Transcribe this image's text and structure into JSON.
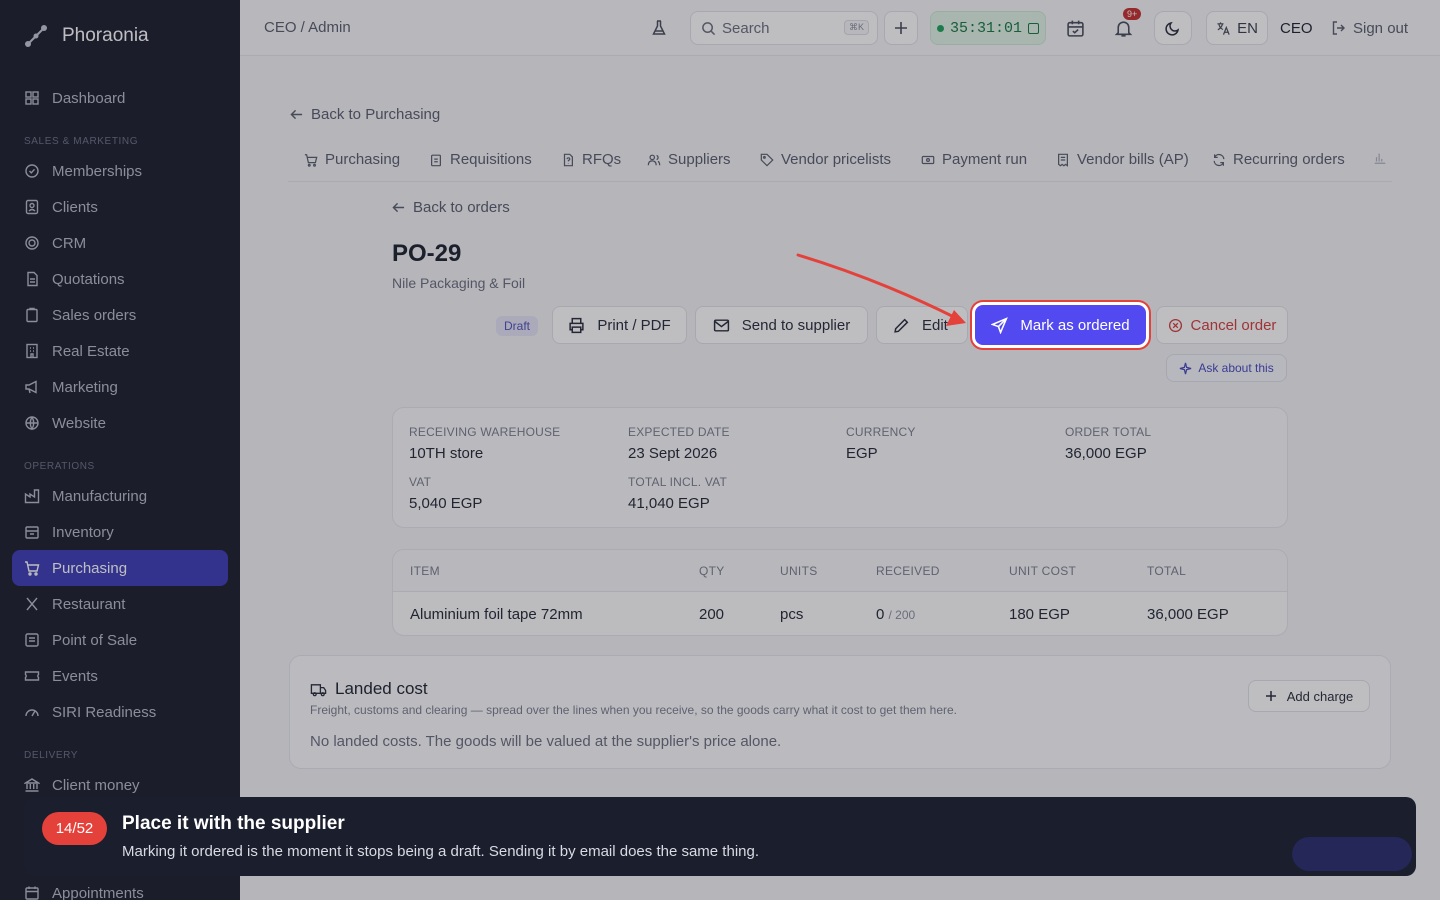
{
  "brand": {
    "name": "Phoraonia"
  },
  "sidebar": {
    "sections": {
      "sales": "SALES & MARKETING",
      "operations": "OPERATIONS",
      "delivery": "DELIVERY"
    },
    "items": [
      {
        "label": "Dashboard",
        "icon": "grid-icon"
      },
      {
        "label": "Memberships",
        "icon": "check-circle-icon"
      },
      {
        "label": "Clients",
        "icon": "contact-icon"
      },
      {
        "label": "CRM",
        "icon": "target-icon"
      },
      {
        "label": "Quotations",
        "icon": "file-icon"
      },
      {
        "label": "Sales orders",
        "icon": "clipboard-icon"
      },
      {
        "label": "Real Estate",
        "icon": "building-icon"
      },
      {
        "label": "Marketing",
        "icon": "megaphone-icon"
      },
      {
        "label": "Website",
        "icon": "globe-icon"
      },
      {
        "label": "Manufacturing",
        "icon": "factory-icon"
      },
      {
        "label": "Inventory",
        "icon": "box-icon"
      },
      {
        "label": "Purchasing",
        "icon": "cart-icon"
      },
      {
        "label": "Restaurant",
        "icon": "utensils-icon"
      },
      {
        "label": "Point of Sale",
        "icon": "terminal-icon"
      },
      {
        "label": "Events",
        "icon": "ticket-icon"
      },
      {
        "label": "SIRI Readiness",
        "icon": "gauge-icon"
      },
      {
        "label": "Client money",
        "icon": "bank-icon"
      },
      {
        "label": "Appointments",
        "icon": "calendar-icon"
      }
    ]
  },
  "topbar": {
    "breadcrumb": "CEO / Admin",
    "search_placeholder": "Search",
    "search_shortcut": "⌘K",
    "timer": "35:31:01",
    "notifications_badge": "9+",
    "language": "EN",
    "role": "CEO",
    "signout": "Sign out"
  },
  "page": {
    "back_purchasing": "Back to Purchasing",
    "tabs": [
      "Purchasing",
      "Requisitions",
      "RFQs",
      "Suppliers",
      "Vendor pricelists",
      "Payment run",
      "Vendor bills (AP)",
      "Recurring orders"
    ],
    "back_orders": "Back to orders",
    "title": "PO-29",
    "supplier": "Nile Packaging & Foil",
    "status": "Draft",
    "actions": {
      "print": "Print / PDF",
      "send": "Send to supplier",
      "edit": "Edit",
      "mark_ordered": "Mark as ordered",
      "cancel": "Cancel order",
      "ask": "Ask about this"
    },
    "summary": {
      "warehouse_label": "RECEIVING WAREHOUSE",
      "warehouse": "10TH store",
      "expected_label": "EXPECTED DATE",
      "expected": "23 Sept 2026",
      "currency_label": "CURRENCY",
      "currency": "EGP",
      "total_label": "ORDER TOTAL",
      "total": "36,000 EGP",
      "vat_label": "VAT",
      "vat": "5,040 EGP",
      "total_vat_label": "TOTAL INCL. VAT",
      "total_vat": "41,040 EGP"
    },
    "lines": {
      "headers": [
        "ITEM",
        "QTY",
        "UNITS",
        "RECEIVED",
        "UNIT COST",
        "TOTAL"
      ],
      "rows": [
        {
          "item": "Aluminium foil tape 72mm",
          "qty": "200",
          "units": "pcs",
          "received": "0",
          "received_of": "/ 200",
          "unit_cost": "180 EGP",
          "total": "36,000 EGP"
        }
      ]
    },
    "landed": {
      "title": "Landed cost",
      "desc": "Freight, customs and clearing — spread over the lines when you receive, so the goods carry what it cost to get them here.",
      "empty": "No landed costs. The goods will be valued at the supplier's price alone.",
      "add": "Add charge"
    }
  },
  "tour": {
    "count": "14/52",
    "title": "Place it with the supplier",
    "body": "Marking it ordered is the moment it stops being a draft. Sending it by email does the same thing."
  },
  "colors": {
    "primary": "#4f46e5",
    "sidebar": "#1e2130",
    "highlight": "#e5413b",
    "timer": "#1a7a44"
  }
}
